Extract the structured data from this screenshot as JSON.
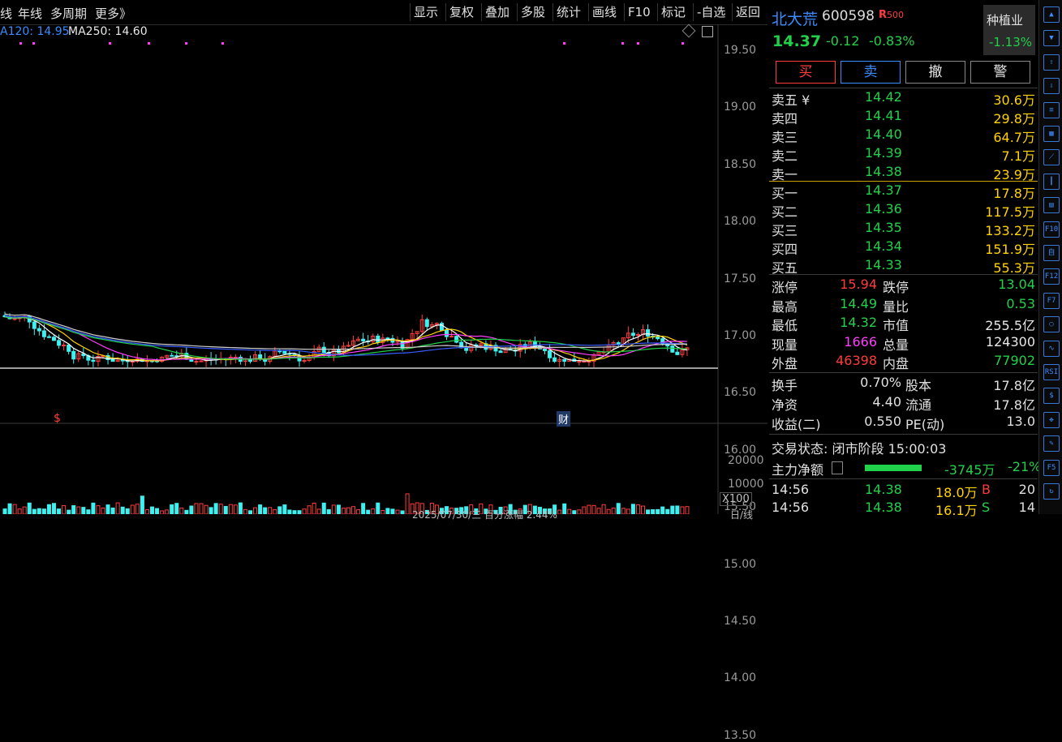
{
  "toolbar": {
    "tabs": [
      "线",
      "年线",
      "多周期",
      "更多》"
    ],
    "buttons": [
      "显示",
      "复权",
      "叠加",
      "多股",
      "统计",
      "画线",
      "F10",
      "标记",
      "-自选",
      "返回"
    ]
  },
  "chart_legend": {
    "ma120": "A120: 14.95",
    "ma250": "MA250: 14.60"
  },
  "price_axis": [
    "19.50",
    "19.00",
    "18.50",
    "18.00",
    "17.50",
    "17.00",
    "16.50",
    "16.00",
    "15.50",
    "15.00",
    "14.50",
    "14.00",
    "13.50"
  ],
  "volume_axis": [
    "20000",
    "10000",
    "X100"
  ],
  "markers": {
    "dollar": "$",
    "cai": "财"
  },
  "bottom_info": "2025/07/30/三  百分涨幅  2.44%",
  "bottom_right": "日/线",
  "stock": {
    "name": "北大荒",
    "code": "600598",
    "badge": "R",
    "badge_num": "500",
    "price": "14.37",
    "change": "-0.12",
    "pct": "-0.83%",
    "industry": "种植业",
    "industry_pct": "-1.13%"
  },
  "trade_buttons": [
    "买",
    "卖",
    "撤",
    "警"
  ],
  "asks": [
    {
      "label": "卖五 ¥",
      "price": "14.42",
      "vol": "30.6万"
    },
    {
      "label": "卖四",
      "price": "14.41",
      "vol": "29.8万"
    },
    {
      "label": "卖三",
      "price": "14.40",
      "vol": "64.7万"
    },
    {
      "label": "卖二",
      "price": "14.39",
      "vol": "7.1万"
    },
    {
      "label": "卖一",
      "price": "14.38",
      "vol": "23.9万"
    }
  ],
  "bids": [
    {
      "label": "买一",
      "price": "14.37",
      "vol": "17.8万"
    },
    {
      "label": "买二",
      "price": "14.36",
      "vol": "117.5万"
    },
    {
      "label": "买三",
      "price": "14.35",
      "vol": "133.2万"
    },
    {
      "label": "买四",
      "price": "14.34",
      "vol": "151.9万"
    },
    {
      "label": "买五",
      "price": "14.33",
      "vol": "55.3万"
    }
  ],
  "stats": [
    {
      "l1": "涨停",
      "v1": "15.94",
      "c1": "red",
      "l2": "跌停",
      "v2": "13.04",
      "c2": "green"
    },
    {
      "l1": "最高",
      "v1": "14.49",
      "c1": "green",
      "l2": "量比",
      "v2": "0.53",
      "c2": "green"
    },
    {
      "l1": "最低",
      "v1": "14.32",
      "c1": "green",
      "l2": "市值",
      "v2": "255.5亿",
      "c2": "white"
    },
    {
      "l1": "现量",
      "v1": "1666",
      "c1": "mag",
      "l2": "总量",
      "v2": "124300",
      "c2": "white"
    },
    {
      "l1": "外盘",
      "v1": "46398",
      "c1": "red",
      "l2": "内盘",
      "v2": "77902",
      "c2": "green"
    }
  ],
  "fundamentals": [
    {
      "l1": "换手",
      "v1": "0.70%",
      "l2": "股本",
      "v2": "17.8亿"
    },
    {
      "l1": "净资",
      "v1": "4.40",
      "l2": "流通",
      "v2": "17.8亿"
    },
    {
      "l1": "收益(二)",
      "v1": "0.550",
      "l2": "PE(动)",
      "v2": "13.0"
    }
  ],
  "trade_status": "交易状态: 闭市阶段 15:00:03",
  "main_flow": {
    "label": "主力净额",
    "value": "-3745万",
    "pct": "-21%"
  },
  "ticks": [
    {
      "time": "14:56",
      "price": "14.38",
      "vol": "18.0万",
      "side": "B",
      "num": "20"
    },
    {
      "time": "14:56",
      "price": "14.38",
      "vol": "16.1万",
      "side": "S",
      "num": "14"
    }
  ],
  "icons": [
    "up-arrow-icon",
    "down-arrow-icon",
    "up-outline-arrow-icon",
    "down-outline-arrow-icon",
    "list-icon",
    "grid-icon",
    "line-chart-icon",
    "candle-icon",
    "board-icon",
    "f10-icon",
    "self-icon",
    "f12-icon",
    "f7-icon",
    "circle-icon",
    "wave-icon",
    "rsi-icon",
    "dollar-icon",
    "move-icon",
    "pen-icon",
    "f5-icon",
    "refresh-icon"
  ],
  "colors": {
    "up": "#ff3c3c",
    "down": "#22d14a",
    "bg": "#000000",
    "accent": "#3a8cff"
  }
}
